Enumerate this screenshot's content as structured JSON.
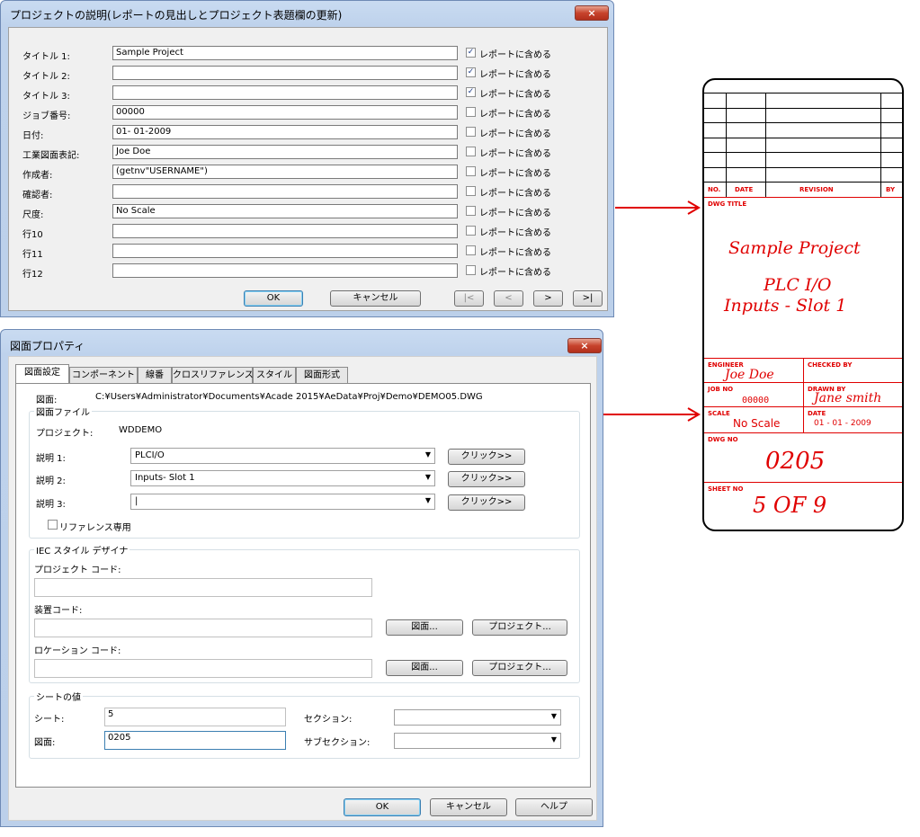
{
  "dialog1": {
    "title": "プロジェクトの説明(レポートの見出しとプロジェクト表題欄の更新)",
    "close": "×",
    "rows": [
      {
        "label": "タイトル 1:",
        "value": "Sample Project",
        "checked": true
      },
      {
        "label": "タイトル 2:",
        "value": "",
        "checked": true
      },
      {
        "label": "タイトル 3:",
        "value": "",
        "checked": true
      },
      {
        "label": "ジョブ番号:",
        "value": "00000",
        "checked": false
      },
      {
        "label": "日付:",
        "value": "01- 01-2009",
        "checked": false
      },
      {
        "label": "工業図面表記:",
        "value": "Joe Doe",
        "checked": false
      },
      {
        "label": "作成者:",
        "value": "(getnv\"USERNAME\")",
        "checked": false
      },
      {
        "label": "確認者:",
        "value": "",
        "checked": false
      },
      {
        "label": "尺度:",
        "value": "No Scale",
        "checked": false
      },
      {
        "label": "行10",
        "value": "",
        "checked": false
      },
      {
        "label": "行11",
        "value": "",
        "checked": false
      },
      {
        "label": "行12",
        "value": "",
        "checked": false
      }
    ],
    "check_label": "レポートに含める",
    "check_mark": "✓",
    "ok": "OK",
    "cancel": "キャンセル",
    "nav_first": "|<",
    "nav_prev": "<",
    "nav_next": ">",
    "nav_last": ">|"
  },
  "dialog2": {
    "title": "図面プロパティ",
    "close": "×",
    "tabs": [
      "図面設定",
      "コンポーネント",
      "線番",
      "クロスリファレンス",
      "スタイル",
      "図面形式"
    ],
    "drawing_label": "図面:",
    "drawing_path": "C:¥Users¥Administrator¥Documents¥Acade 2015¥AeData¥Proj¥Demo¥DEMO05.DWG",
    "file_group": "図面ファイル",
    "project_label": "プロジェクト:",
    "project_value": "WDDEMO",
    "desc1_label": "説明 1:",
    "desc1_value": "PLCI/O",
    "desc2_label": "説明 2:",
    "desc2_value": "Inputs- Slot 1",
    "desc3_label": "説明 3:",
    "desc3_value": "|",
    "click_label": "クリック>>",
    "reference_only": "リファレンス専用",
    "iec_group": "IEC スタイル デザイナ",
    "project_code_label": "プロジェクト コード:",
    "installation_code_label": "装置コード:",
    "location_code_label": "ロケーション コード:",
    "drawing_btn": "図面...",
    "project_btn": "プロジェクト...",
    "sheet_group": "シートの値",
    "sheet_label": "シート:",
    "sheet_value": "5",
    "drawing_no_label": "図面:",
    "drawing_no_value": "0205",
    "section_label": "セクション:",
    "subsection_label": "サブセクション:",
    "arrow_glyph": "▼",
    "ok": "OK",
    "cancel": "キャンセル",
    "help": "ヘルプ"
  },
  "title_block": {
    "rev_no": "NO.",
    "rev_date": "DATE",
    "rev_revision": "REVISION",
    "rev_by": "BY",
    "dwg_title_label": "DWG TITLE",
    "title1": "Sample Project",
    "title2": "PLC I/O",
    "title3": "Inputs - Slot 1",
    "engineer_label": "ENGINEER",
    "engineer_value": "Joe Doe",
    "checked_by_label": "CHECKED BY",
    "job_no_label": "JOB NO",
    "job_no_value": "00000",
    "drawn_by_label": "DRAWN BY",
    "drawn_by_value": "Jane smith",
    "scale_label": "SCALE",
    "scale_value": "No Scale",
    "date_label": "DATE",
    "date_value": "01 - 01 - 2009",
    "dwg_no_label": "DWG NO",
    "dwg_no_value": "0205",
    "sheet_no_label": "SHEET NO",
    "sheet_no_value": "5 OF 9"
  },
  "colors": {
    "arrow": "#e00000",
    "titleblock_text": "#e00000"
  }
}
